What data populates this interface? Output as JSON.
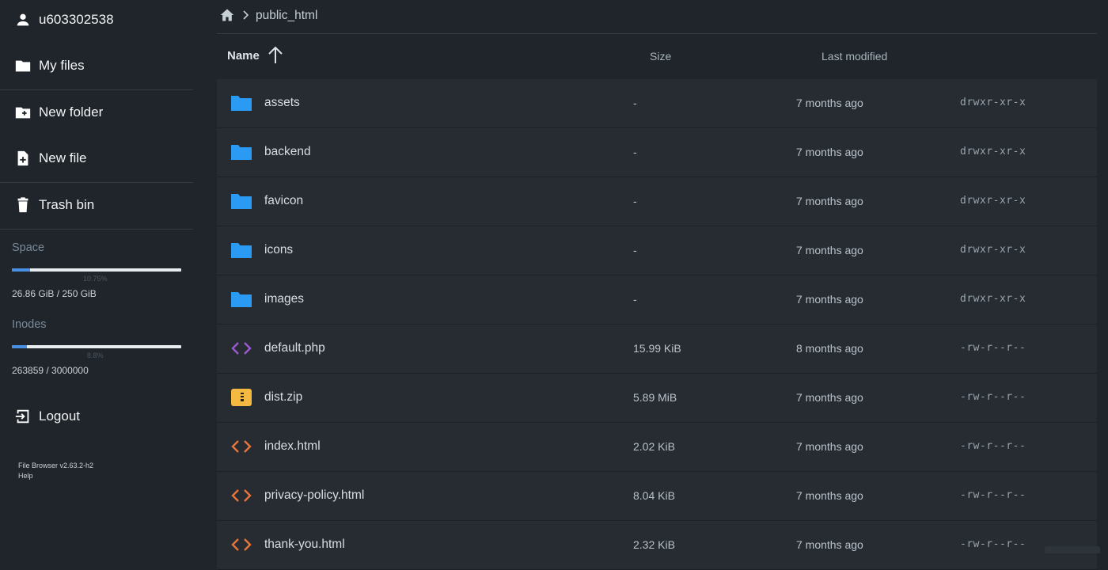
{
  "user": {
    "name": "u603302538"
  },
  "nav": {
    "my_files": "My files",
    "new_folder": "New folder",
    "new_file": "New file",
    "trash": "Trash bin",
    "logout": "Logout"
  },
  "space": {
    "title": "Space",
    "percent_label": "10.75%",
    "fraction": 0.1075,
    "usage": "26.86 GiB / 250 GiB"
  },
  "inodes": {
    "title": "Inodes",
    "percent_label": "8.8%",
    "fraction": 0.088,
    "usage": "263859 / 3000000"
  },
  "footer": {
    "version": "File Browser v2.63.2-h2",
    "help": "Help"
  },
  "breadcrumb": {
    "current": "public_html"
  },
  "table": {
    "headers": {
      "name": "Name",
      "size": "Size",
      "modified": "Last modified"
    },
    "rows": [
      {
        "name": "assets",
        "type": "folder",
        "size": "-",
        "modified": "7 months ago",
        "perm": "drwxr-xr-x"
      },
      {
        "name": "backend",
        "type": "folder",
        "size": "-",
        "modified": "7 months ago",
        "perm": "drwxr-xr-x"
      },
      {
        "name": "favicon",
        "type": "folder",
        "size": "-",
        "modified": "7 months ago",
        "perm": "drwxr-xr-x"
      },
      {
        "name": "icons",
        "type": "folder",
        "size": "-",
        "modified": "7 months ago",
        "perm": "drwxr-xr-x"
      },
      {
        "name": "images",
        "type": "folder",
        "size": "-",
        "modified": "7 months ago",
        "perm": "drwxr-xr-x"
      },
      {
        "name": "default.php",
        "type": "code-php",
        "size": "15.99 KiB",
        "modified": "8 months ago",
        "perm": "-rw-r--r--"
      },
      {
        "name": "dist.zip",
        "type": "archive",
        "size": "5.89 MiB",
        "modified": "7 months ago",
        "perm": "-rw-r--r--"
      },
      {
        "name": "index.html",
        "type": "code-html",
        "size": "2.02 KiB",
        "modified": "7 months ago",
        "perm": "-rw-r--r--"
      },
      {
        "name": "privacy-policy.html",
        "type": "code-html",
        "size": "8.04 KiB",
        "modified": "7 months ago",
        "perm": "-rw-r--r--"
      },
      {
        "name": "thank-you.html",
        "type": "code-html",
        "size": "2.32 KiB",
        "modified": "7 months ago",
        "perm": "-rw-r--r--"
      }
    ]
  },
  "colors": {
    "background": "#1f252b",
    "folder": "#2b9af3",
    "php": "#9b59d0",
    "html": "#e8743b",
    "archive": "#f5b942",
    "accent": "#4a90e2"
  },
  "icons": {
    "user": "person-icon",
    "my_files": "folder-icon",
    "new_folder": "folder-plus-icon",
    "new_file": "file-plus-icon",
    "trash": "trash-icon",
    "logout": "logout-icon",
    "home": "home-icon",
    "sort": "arrow-up-icon"
  }
}
